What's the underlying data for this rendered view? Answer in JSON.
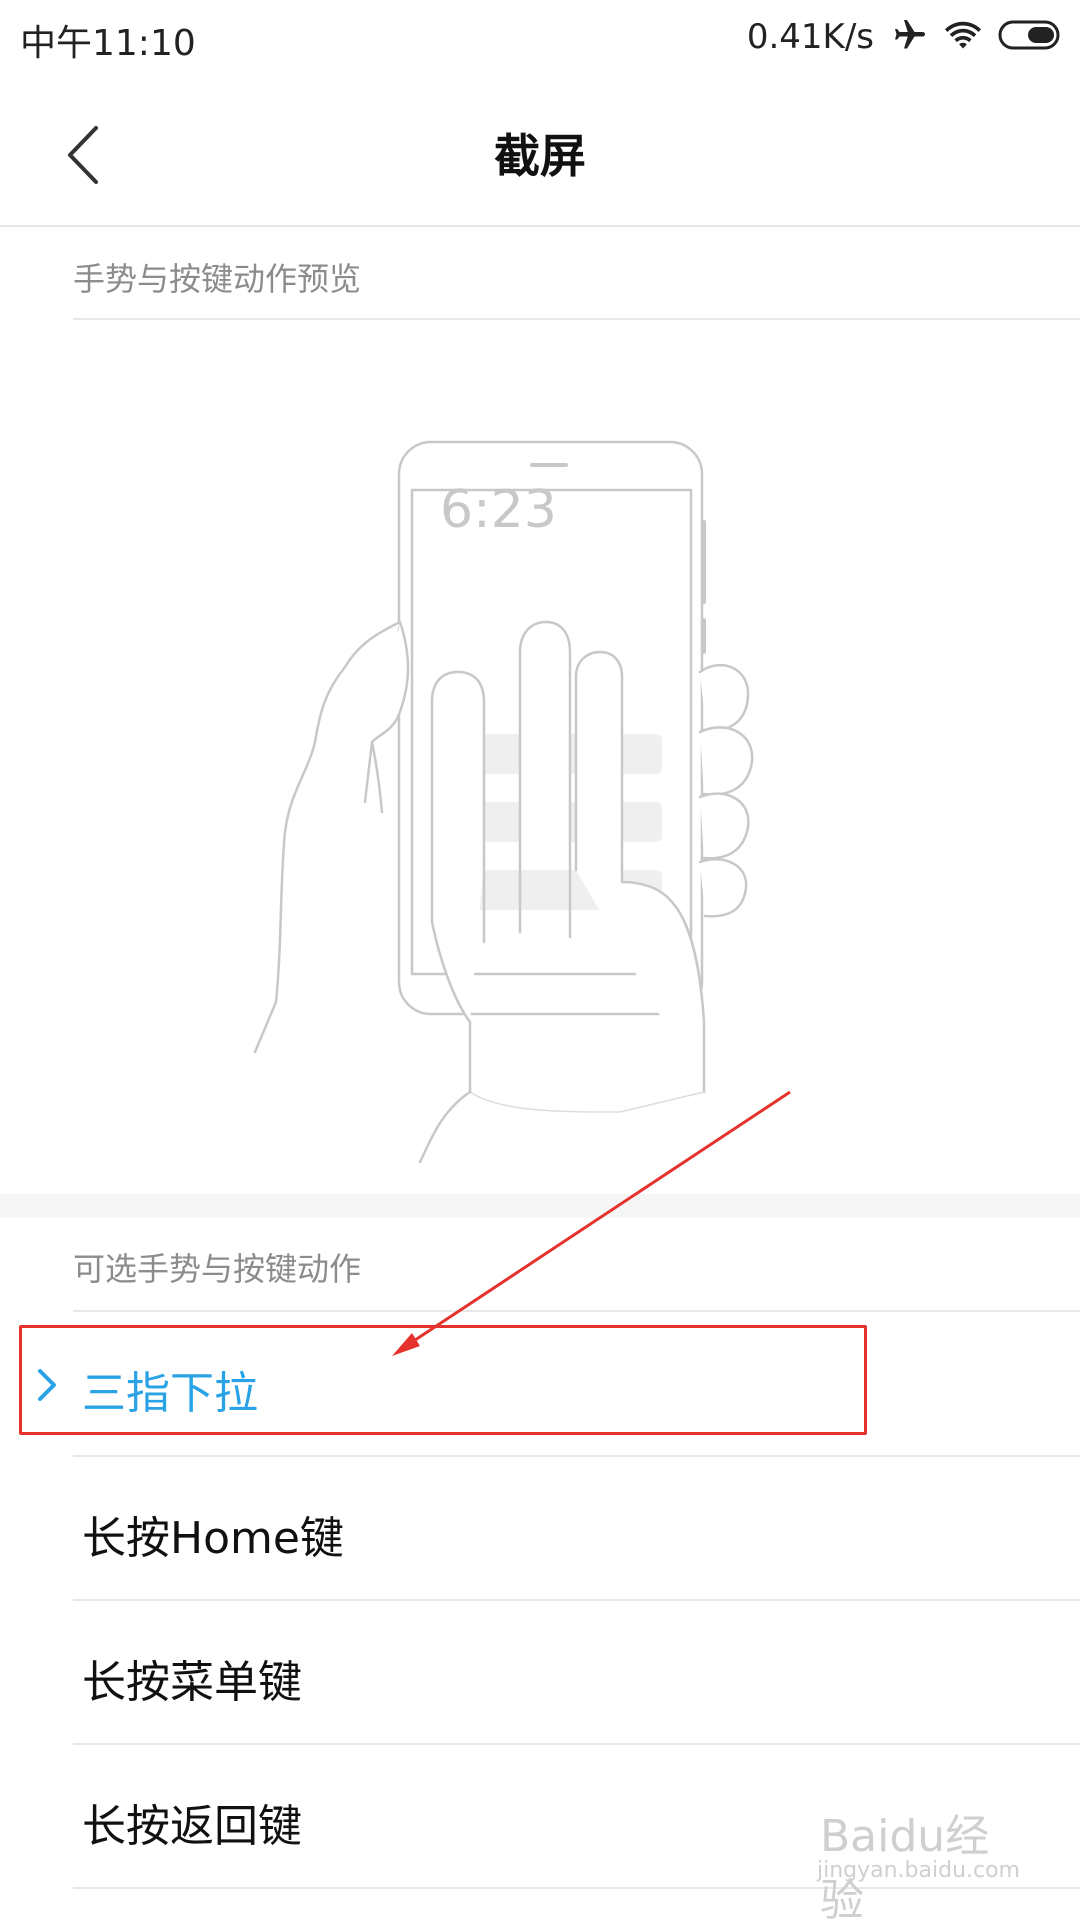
{
  "status_bar": {
    "time": "中午11:10",
    "net_speed": "0.41K/s",
    "icons": [
      "airplane-icon",
      "wifi-icon",
      "battery-icon"
    ]
  },
  "app_bar": {
    "title": "截屏",
    "back_icon": "chevron-left-icon"
  },
  "preview_section": {
    "header": "手势与按键动作预览",
    "phone_clock": "6:23"
  },
  "options_section": {
    "header": "可选手势与按键动作",
    "items": [
      {
        "label": "三指下拉",
        "selected": true
      },
      {
        "label": "长按Home键",
        "selected": false
      },
      {
        "label": "长按菜单键",
        "selected": false
      },
      {
        "label": "长按返回键",
        "selected": false
      }
    ]
  },
  "watermark": {
    "top": "Baidu经验",
    "bottom": "jingyan.baidu.com"
  },
  "colors": {
    "accent": "#2aa3e6",
    "annotation": "#e5322d",
    "divider": "#e8e8e8",
    "secondary_text": "#8c8c8c"
  }
}
